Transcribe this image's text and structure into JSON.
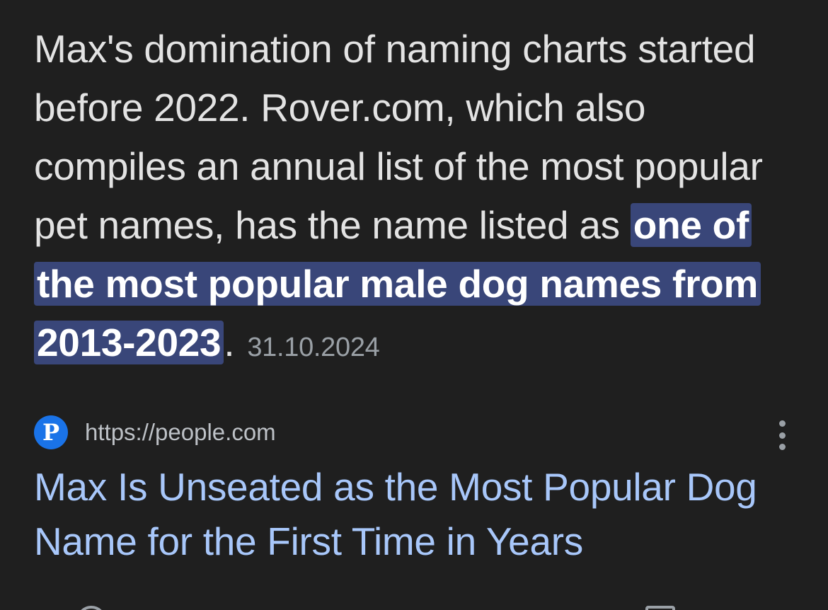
{
  "snippet": {
    "text_before": "Max's domination of naming charts started before 2022. Rover.com, which also compiles an annual list of the most popular pet names, has the name listed as ",
    "highlight": "one of the most popular male dog names from 2013-2023",
    "text_after": ".",
    "date": "31.10.2024",
    "highlight_color": "#394679"
  },
  "source": {
    "favicon_letter": "P",
    "favicon_color": "#1a73e8",
    "url": "https://people.com",
    "more_icon": "more-vert-icon"
  },
  "result": {
    "title": "Max Is Unseated as the Most Popular Dog Name for the First Time in Years",
    "title_color": "#a8c7fa"
  }
}
